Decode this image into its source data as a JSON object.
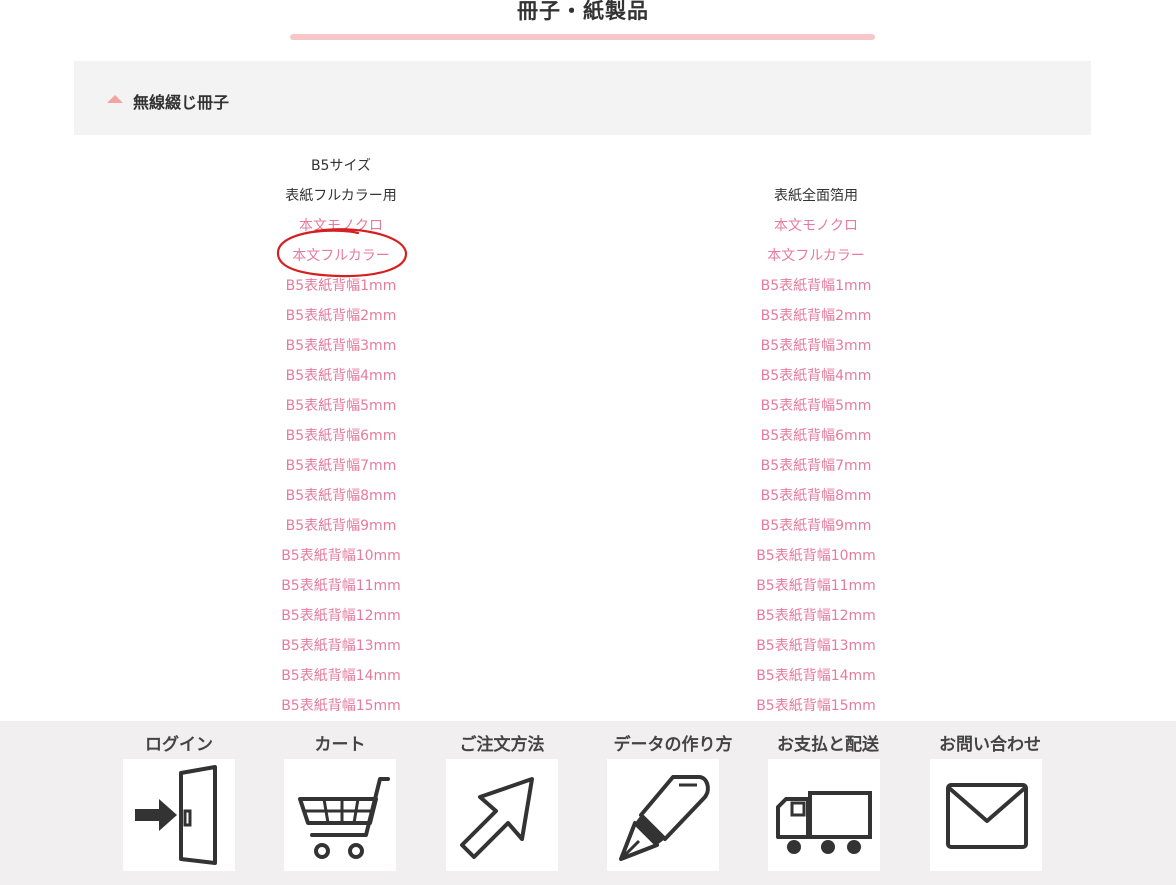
{
  "page": {
    "title": "冊子・紙製品",
    "accent_color": "#f7c6c8",
    "link_color": "#e67b9d"
  },
  "accordion": {
    "label": "無線綴じ冊子",
    "icon": "triangle-up-icon"
  },
  "size_heading": "B5サイズ",
  "columns": [
    {
      "heading": "表紙フルカラー用",
      "links": [
        "本文モノクロ",
        "本文フルカラー",
        "B5表紙背幅1mm",
        "B5表紙背幅2mm",
        "B5表紙背幅3mm",
        "B5表紙背幅4mm",
        "B5表紙背幅5mm",
        "B5表紙背幅6mm",
        "B5表紙背幅7mm",
        "B5表紙背幅8mm",
        "B5表紙背幅9mm",
        "B5表紙背幅10mm",
        "B5表紙背幅11mm",
        "B5表紙背幅12mm",
        "B5表紙背幅13mm",
        "B5表紙背幅14mm",
        "B5表紙背幅15mm"
      ]
    },
    {
      "heading": "表紙全面箔用",
      "links": [
        "本文モノクロ",
        "本文フルカラー",
        "B5表紙背幅1mm",
        "B5表紙背幅2mm",
        "B5表紙背幅3mm",
        "B5表紙背幅4mm",
        "B5表紙背幅5mm",
        "B5表紙背幅6mm",
        "B5表紙背幅7mm",
        "B5表紙背幅8mm",
        "B5表紙背幅9mm",
        "B5表紙背幅10mm",
        "B5表紙背幅11mm",
        "B5表紙背幅12mm",
        "B5表紙背幅13mm",
        "B5表紙背幅14mm",
        "B5表紙背幅15mm"
      ]
    }
  ],
  "footer": {
    "items": [
      {
        "label": "ログイン",
        "icon": "door-login-icon"
      },
      {
        "label": "カート",
        "icon": "shopping-cart-icon"
      },
      {
        "label": "ご注文方法",
        "icon": "arrow-icon"
      },
      {
        "label": "データの作り方",
        "icon": "pen-icon"
      },
      {
        "label": "お支払と配送",
        "icon": "truck-icon"
      },
      {
        "label": "お問い合わせ",
        "icon": "envelope-icon"
      }
    ]
  },
  "annotation": {
    "icon": "red-circle-annotation",
    "color": "#d42020"
  }
}
